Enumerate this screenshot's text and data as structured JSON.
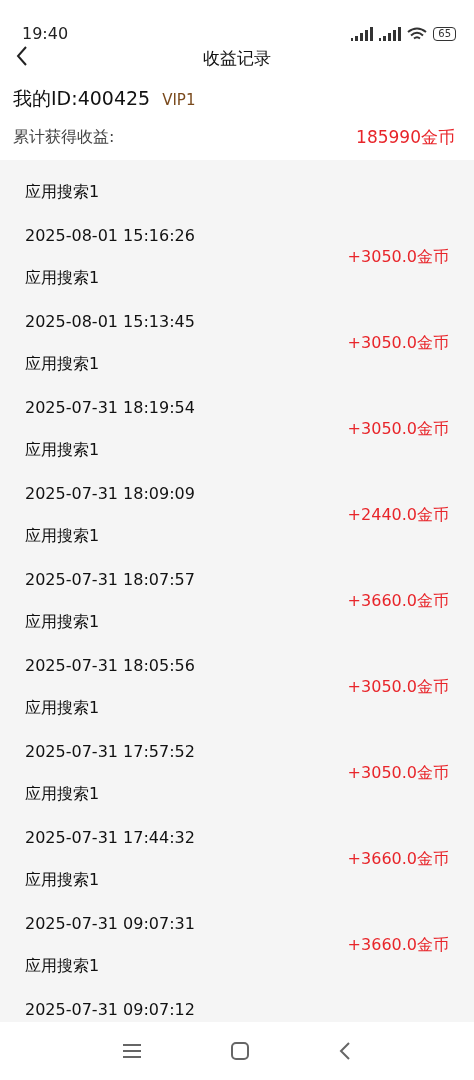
{
  "status_bar": {
    "time": "19:40",
    "battery": "65"
  },
  "header": {
    "title": "收益记录"
  },
  "account": {
    "id_label": "我的ID:400425",
    "vip": "VIP1"
  },
  "summary": {
    "label": "累计获得收益:",
    "value": "185990金币"
  },
  "records": [
    {
      "name": "应用搜索1"
    },
    {
      "date": "2025-08-01 15:16:26",
      "name": "应用搜索1",
      "amount": "+3050.0金币"
    },
    {
      "date": "2025-08-01 15:13:45",
      "name": "应用搜索1",
      "amount": "+3050.0金币"
    },
    {
      "date": "2025-07-31 18:19:54",
      "name": "应用搜索1",
      "amount": "+3050.0金币"
    },
    {
      "date": "2025-07-31 18:09:09",
      "name": "应用搜索1",
      "amount": "+2440.0金币"
    },
    {
      "date": "2025-07-31 18:07:57",
      "name": "应用搜索1",
      "amount": "+3660.0金币"
    },
    {
      "date": "2025-07-31 18:05:56",
      "name": "应用搜索1",
      "amount": "+3050.0金币"
    },
    {
      "date": "2025-07-31 17:57:52",
      "name": "应用搜索1",
      "amount": "+3050.0金币"
    },
    {
      "date": "2025-07-31 17:44:32",
      "name": "应用搜索1",
      "amount": "+3660.0金币"
    },
    {
      "date": "2025-07-31 09:07:31",
      "name": "应用搜索1",
      "amount": "+3660.0金币"
    },
    {
      "date": "2025-07-31 09:07:12"
    }
  ]
}
